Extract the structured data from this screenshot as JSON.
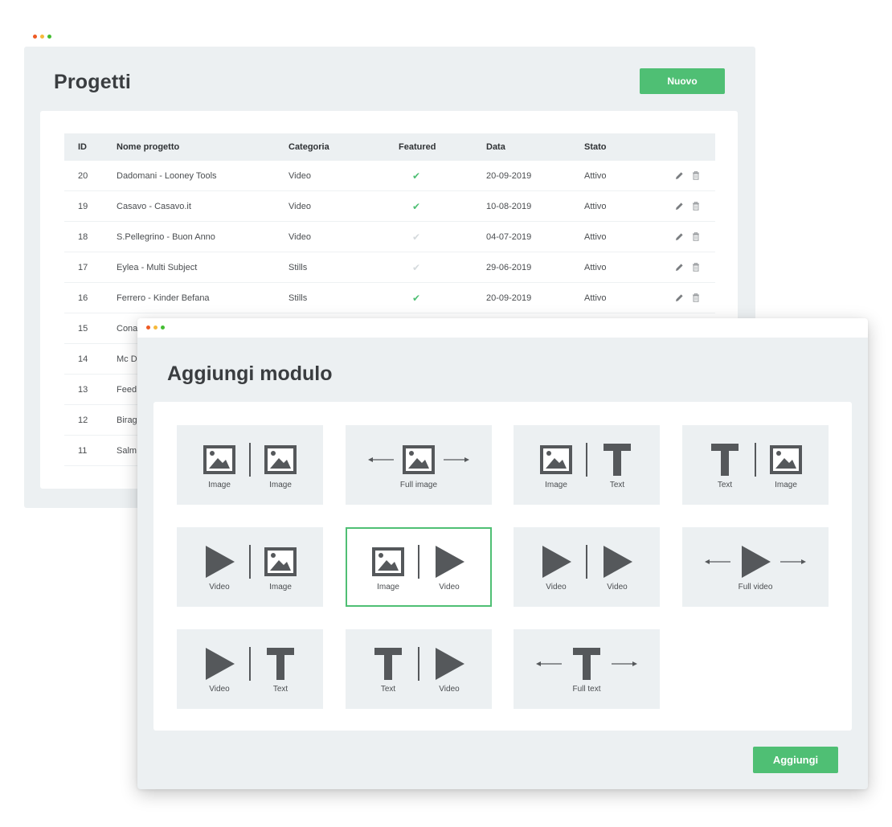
{
  "colors": {
    "accent": "#4fbf74",
    "panel": "#ecf0f2",
    "icon": "#55585b",
    "dot_red": "#ee5a24",
    "dot_yellow": "#f6b93b",
    "dot_green": "#44bd32"
  },
  "projects": {
    "title": "Progetti",
    "new_label": "Nuovo",
    "columns": {
      "id": "ID",
      "name": "Nome progetto",
      "category": "Categoria",
      "featured": "Featured",
      "date": "Data",
      "status": "Stato"
    },
    "rows": [
      {
        "id": "20",
        "name": "Dadomani - Looney Tools",
        "category": "Video",
        "featured": true,
        "date": "20-09-2019",
        "status": "Attivo"
      },
      {
        "id": "19",
        "name": "Casavo - Casavo.it",
        "category": "Video",
        "featured": true,
        "date": "10-08-2019",
        "status": "Attivo"
      },
      {
        "id": "18",
        "name": "S.Pellegrino - Buon Anno",
        "category": "Video",
        "featured": false,
        "date": "04-07-2019",
        "status": "Attivo"
      },
      {
        "id": "17",
        "name": "Eylea - Multi Subject",
        "category": "Stills",
        "featured": false,
        "date": "29-06-2019",
        "status": "Attivo"
      },
      {
        "id": "16",
        "name": "Ferrero - Kinder Befana",
        "category": "Stills",
        "featured": true,
        "date": "20-09-2019",
        "status": "Attivo"
      },
      {
        "id": "15",
        "name": "Cona",
        "category": "",
        "featured": null,
        "date": "",
        "status": ""
      },
      {
        "id": "14",
        "name": "Mc D",
        "category": "",
        "featured": null,
        "date": "",
        "status": ""
      },
      {
        "id": "13",
        "name": "Feed",
        "category": "",
        "featured": null,
        "date": "",
        "status": ""
      },
      {
        "id": "12",
        "name": "Birag",
        "category": "",
        "featured": null,
        "date": "",
        "status": ""
      },
      {
        "id": "11",
        "name": "Salm",
        "category": "",
        "featured": null,
        "date": "",
        "status": ""
      }
    ],
    "check_glyph": "✔",
    "row_actions": [
      "pencil-icon",
      "trash-icon"
    ]
  },
  "modal": {
    "title": "Aggiungi modulo",
    "add_label": "Aggiungi",
    "modules": [
      {
        "type": "split",
        "left": "image",
        "right": "image",
        "labels": [
          "Image",
          "Image"
        ],
        "selected": false
      },
      {
        "type": "full",
        "icon": "image",
        "label": "Full image",
        "selected": false
      },
      {
        "type": "split",
        "left": "image",
        "right": "text",
        "labels": [
          "Image",
          "Text"
        ],
        "selected": false
      },
      {
        "type": "split",
        "left": "text",
        "right": "image",
        "labels": [
          "Text",
          "Image"
        ],
        "selected": false
      },
      {
        "type": "split",
        "left": "video",
        "right": "image",
        "labels": [
          "Video",
          "Image"
        ],
        "selected": false
      },
      {
        "type": "split",
        "left": "image",
        "right": "video",
        "labels": [
          "Image",
          "Video"
        ],
        "selected": true
      },
      {
        "type": "split",
        "left": "video",
        "right": "video",
        "labels": [
          "Video",
          "Video"
        ],
        "selected": false
      },
      {
        "type": "full",
        "icon": "video",
        "label": "Full video",
        "selected": false
      },
      {
        "type": "split",
        "left": "video",
        "right": "text",
        "labels": [
          "Video",
          "Text"
        ],
        "selected": false
      },
      {
        "type": "split",
        "left": "text",
        "right": "video",
        "labels": [
          "Text",
          "Video"
        ],
        "selected": false
      },
      {
        "type": "full",
        "icon": "text",
        "label": "Full text",
        "selected": false
      }
    ]
  }
}
